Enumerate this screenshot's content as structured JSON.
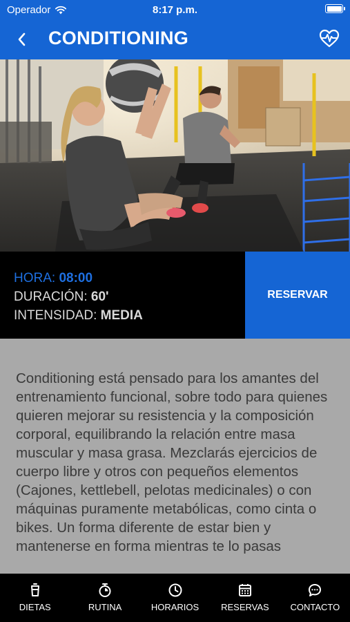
{
  "status_bar": {
    "carrier": "Operador",
    "time": "8:17 p.m."
  },
  "nav": {
    "title": "CONDITIONING",
    "back_icon": "chevron-left-icon",
    "action_icon": "heart-pulse-icon"
  },
  "class_info": {
    "hora_label": "HORA:",
    "hora_value": "08:00",
    "duracion_label": "DURACIÓN:",
    "duracion_value": "60'",
    "intensidad_label": "INTENSIDAD:",
    "intensidad_value": "MEDIA",
    "reserve_label": "RESERVAR"
  },
  "description": "Conditioning está pensado para los amantes del entrenamiento funcional, sobre todo para quienes quieren mejorar su resistencia y la composición corporal, equilibrando la relación entre masa muscular y masa grasa. Mezclarás ejercicios de cuerpo libre y otros con pequeños elementos (Cajones, kettlebell, pelotas medicinales) o con máquinas puramente metabólicas, como cinta o bikes. Un forma diferente de estar bien y mantenerse en forma mientras te lo pasas",
  "tabs": [
    {
      "label": "DIETAS",
      "icon": "cup-icon"
    },
    {
      "label": "RUTINA",
      "icon": "stopwatch-icon"
    },
    {
      "label": "HORARIOS",
      "icon": "clock-icon"
    },
    {
      "label": "RESERVAS",
      "icon": "calendar-icon"
    },
    {
      "label": "CONTACTO",
      "icon": "chat-bubble-icon"
    }
  ],
  "colors": {
    "brand_blue": "#1565d4",
    "info_background": "#000000",
    "description_background": "#a9a9a9"
  }
}
